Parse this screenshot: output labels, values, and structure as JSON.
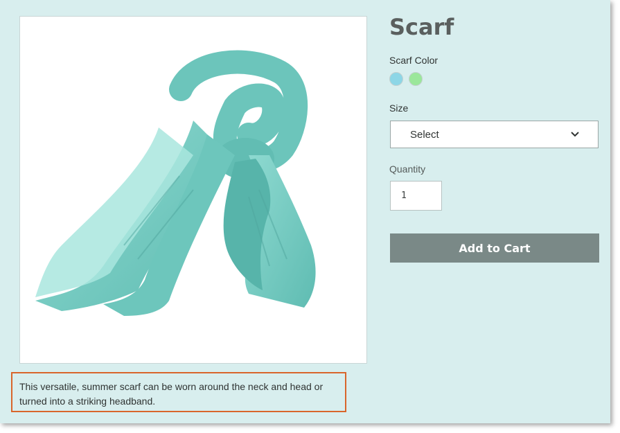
{
  "product": {
    "title": "Scarf",
    "image_alt": "Teal scarf product photo",
    "color_label": "Scarf Color",
    "colors": [
      {
        "name": "light-blue",
        "hex": "#8dd6e6"
      },
      {
        "name": "light-green",
        "hex": "#9be79b"
      }
    ],
    "size_label": "Size",
    "size_select_value": "Select",
    "quantity_label": "Quantity",
    "quantity_value": "1",
    "add_to_cart_label": "Add to Cart",
    "description": "This versatile, summer scarf can be worn around the neck and head or turned into a striking headband."
  },
  "theme": {
    "background": "#d8eeee",
    "button": "#7a8987",
    "highlight_border": "#d9652b",
    "scarf_color": "#7ccfc6"
  }
}
